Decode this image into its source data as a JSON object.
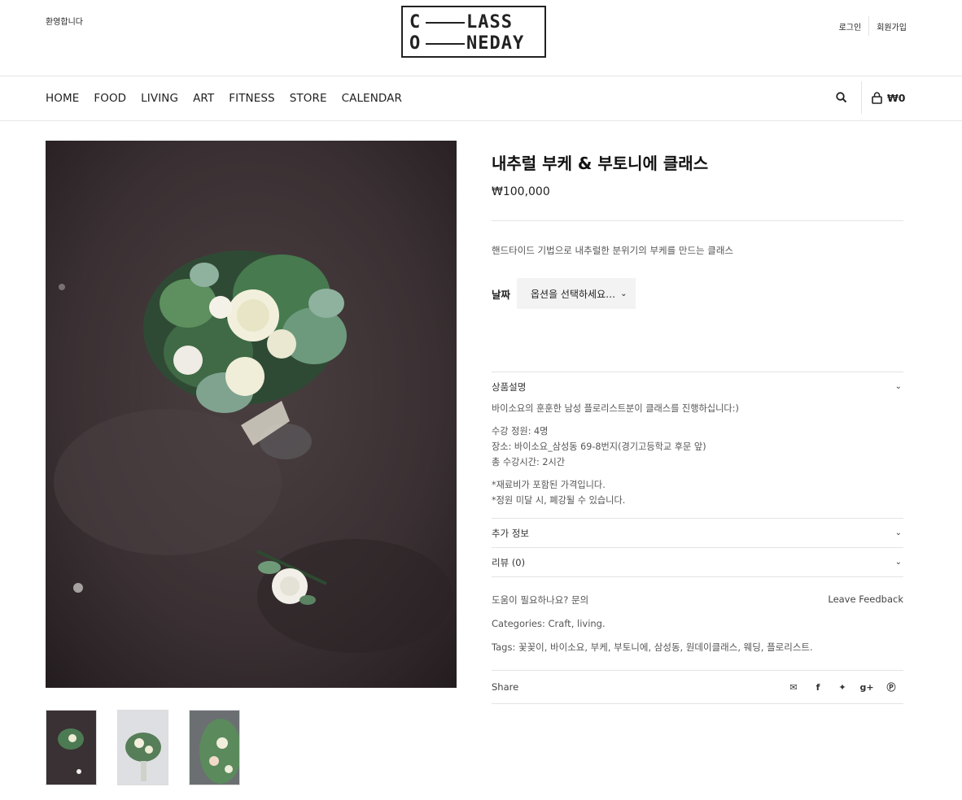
{
  "header": {
    "welcome": "환영합니다",
    "logo": {
      "line1_left": "C",
      "line1_right": "LASS",
      "line2_left": "O",
      "line2_right": "NEDAY"
    },
    "login": "로그인",
    "register": "회원가입"
  },
  "nav": {
    "items": [
      "HOME",
      "FOOD",
      "LIVING",
      "ART",
      "FITNESS",
      "STORE",
      "CALENDAR"
    ],
    "cart_total": "₩0"
  },
  "product": {
    "title": "내추럴 부케 & 부토니에 클래스",
    "price": "₩100,000",
    "short_description": "핸드타이드 기법으로 내추럴한 분위기의 부케를 만드는 클래스",
    "variation_label": "날짜",
    "select_placeholder": "옵션을 선택하세요…",
    "tabs": {
      "description_title": "상품설명",
      "description_lines": {
        "intro": "바이소요의 훈훈한 남성 플로리스트분이 클래스를 진행하십니다:)",
        "capacity": "수강 정원: 4명",
        "place": "장소: 바이소요_삼성동 69-8번지(경기고등학교 후문 앞)",
        "duration": "총 수강시간: 2시간",
        "note1": "*재료비가 포함된 가격입니다.",
        "note2": "*정원 미달 시, 폐강될 수 있습니다."
      },
      "additional_title": "추가 정보",
      "reviews_title": "리뷰 (0)"
    },
    "help_text": "도움이 필요하나요? 문의",
    "feedback": "Leave Feedback",
    "categories_label": "Categories:",
    "categories": "Craft, living.",
    "tags_label": "Tags:",
    "tags": "꽃꽂이, 바이소요, 부케, 부토니에, 삼성동, 원데이클래스, 웨딩, 플로리스트.",
    "share_label": "Share"
  },
  "colors": {
    "text": "#222222",
    "muted": "#555555",
    "border": "#e4e4e4",
    "select_bg": "#f3f3f3"
  }
}
